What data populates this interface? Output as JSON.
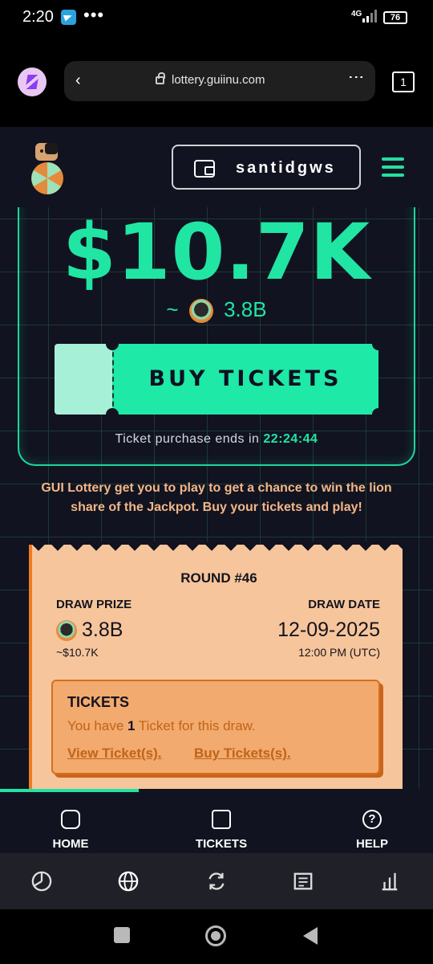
{
  "status_bar": {
    "time": "2:20",
    "dots": "•••",
    "network": "4G",
    "battery": "76"
  },
  "browser": {
    "url": "lottery.guiinu.com",
    "tab_count": "1",
    "back_glyph": "‹",
    "menu_glyph": "⋮"
  },
  "header": {
    "username": "santidgws"
  },
  "jackpot": {
    "usd": "$10.7K",
    "prefix": "~",
    "token_amount": "3.8B"
  },
  "buy_button": {
    "label": "BUY TICKETS"
  },
  "countdown": {
    "text": "Ticket purchase ends in",
    "time": "22:24:44"
  },
  "description": "GUI Lottery get you to play to get a chance to win the lion share of the Jackpot. Buy your tickets and play!",
  "round": {
    "title": "ROUND #46",
    "prize_label": "DRAW PRIZE",
    "prize_token": "3.8B",
    "prize_usd": "~$10.7K",
    "date_label": "DRAW DATE",
    "date": "12-09-2025",
    "time": "12:00 PM (UTC)"
  },
  "tickets_box": {
    "title": "TICKETS",
    "line_prefix": "You have",
    "count": "1",
    "line_suffix": "Ticket for this draw.",
    "view_link": "View Ticket(s).",
    "buy_link": "Buy Tickets(s)."
  },
  "scroll_progress": 0.32,
  "bottom_nav": {
    "home": "HOME",
    "tickets": "TICKETS",
    "help": "HELP"
  },
  "colors": {
    "accent": "#21e5a3",
    "background": "#111320",
    "card": "#f7c59c",
    "orange": "#ee7b22"
  }
}
